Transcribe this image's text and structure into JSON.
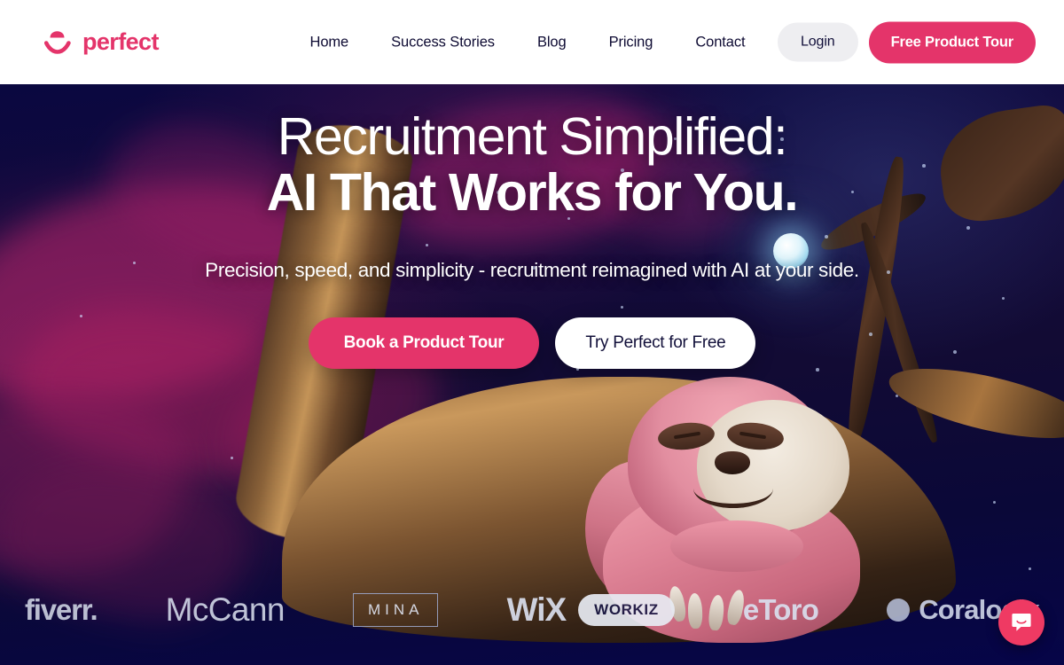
{
  "brand": {
    "name": "perfect",
    "mark_icon": "smiling-face-mark"
  },
  "nav": {
    "items": [
      {
        "label": "Home"
      },
      {
        "label": "Success Stories"
      },
      {
        "label": "Blog"
      },
      {
        "label": "Pricing"
      },
      {
        "label": "Contact"
      }
    ]
  },
  "header_actions": {
    "login_label": "Login",
    "tour_label": "Free Product Tour"
  },
  "hero": {
    "heading_line1": "Recruitment Simplified:",
    "heading_line2": "AI That Works for You.",
    "subheading": "Precision, speed, and simplicity - recruitment reimagined with AI at your side.",
    "primary_cta": "Book a Product Tour",
    "secondary_cta": "Try Perfect for Free"
  },
  "logo_strip": {
    "fiverr": "fiverr.",
    "mccann": "McCann",
    "mina": "MINA",
    "wix": "WiX",
    "workiz": "WORKIZ",
    "etoro": "eToro",
    "coralogix": "Coralogix"
  },
  "chat": {
    "icon": "chat-bubble-icon"
  },
  "colors": {
    "brand_pink": "#e4346a",
    "hero_navy": "#0a0840",
    "nav_text": "#0e0b33",
    "login_bg": "#eeeef1",
    "chat_bg": "#ef3a63"
  }
}
